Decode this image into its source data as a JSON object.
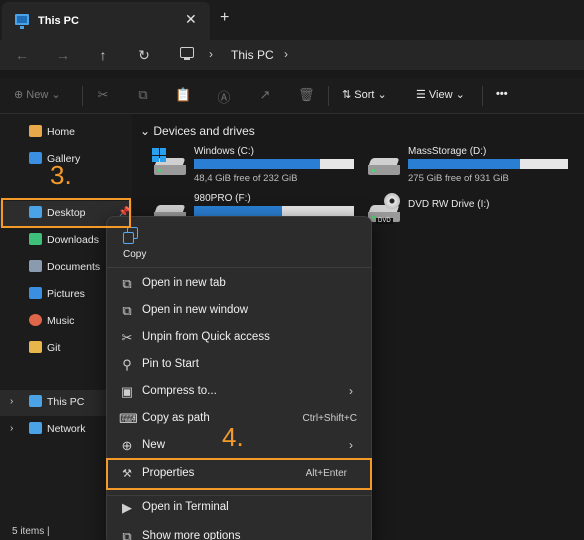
{
  "window": {
    "tab_title": "This PC",
    "tab_close": "✕",
    "new_tab": "+"
  },
  "nav": {
    "back": "←",
    "forward": "→",
    "up": "↑",
    "refresh": "↻",
    "chevron": "›",
    "location": "This PC"
  },
  "commands": {
    "new_label": "New",
    "sort_label": "Sort",
    "view_label": "View",
    "more": "•••"
  },
  "sidebar": {
    "items": [
      {
        "label": "Home",
        "icon": "home-icon",
        "color": "#e9a94b"
      },
      {
        "label": "Gallery",
        "icon": "gallery-icon",
        "color": "#3a8fe0"
      },
      {
        "label": "Desktop",
        "icon": "desktop-icon",
        "color": "#4aa3e6"
      },
      {
        "label": "Downloads",
        "icon": "downloads-icon",
        "color": "#3fc07a"
      },
      {
        "label": "Documents",
        "icon": "documents-icon",
        "color": "#8a9bb0"
      },
      {
        "label": "Pictures",
        "icon": "pictures-icon",
        "color": "#3a8fe0"
      },
      {
        "label": "Music",
        "icon": "music-icon",
        "color": "#e0664a"
      },
      {
        "label": "Git",
        "icon": "folder-icon",
        "color": "#e8b64a"
      },
      {
        "label": "This PC",
        "icon": "this-pc-icon",
        "color": "#4aa3e6"
      },
      {
        "label": "Network",
        "icon": "network-icon",
        "color": "#4aa3e6"
      }
    ],
    "status": "5 items  |"
  },
  "main": {
    "group_title": "Devices and drives",
    "drives": [
      {
        "name": "Windows (C:)",
        "free": "48,4 GiB free of 232 GiB",
        "used_fraction": 0.79
      },
      {
        "name": "MassStorage (D:)",
        "free": "275 GiB free of 931 GiB",
        "used_fraction": 0.7
      },
      {
        "name": "980PRO (F:)",
        "free": "",
        "used_fraction": 0.55
      },
      {
        "name": "DVD RW Drive (I:)",
        "free": ""
      }
    ],
    "dvd_tag": "DVD"
  },
  "context_menu": {
    "copy_label": "Copy",
    "items": [
      {
        "label": "Open in new tab",
        "icon": "open-new-tab-icon",
        "glyph": "⧉",
        "shortcut": "",
        "submenu": false
      },
      {
        "label": "Open in new window",
        "icon": "open-new-window-icon",
        "glyph": "⧉",
        "shortcut": "",
        "submenu": false
      },
      {
        "label": "Unpin from Quick access",
        "icon": "unpin-icon",
        "glyph": "✂",
        "shortcut": "",
        "submenu": false
      },
      {
        "label": "Pin to Start",
        "icon": "pin-icon",
        "glyph": "⚲",
        "shortcut": "",
        "submenu": false
      },
      {
        "label": "Compress to...",
        "icon": "compress-icon",
        "glyph": "▣",
        "shortcut": "",
        "submenu": true
      },
      {
        "label": "Copy as path",
        "icon": "copy-path-icon",
        "glyph": "⌨",
        "shortcut": "Ctrl+Shift+C",
        "submenu": false
      },
      {
        "label": "New",
        "icon": "new-icon",
        "glyph": "⊕",
        "shortcut": "",
        "submenu": true
      },
      {
        "label": "Properties",
        "icon": "properties-icon",
        "glyph": "🔧",
        "shortcut": "Alt+Enter",
        "submenu": false
      },
      {
        "label": "Open in Terminal",
        "icon": "terminal-icon",
        "glyph": "▶",
        "shortcut": "",
        "submenu": false
      },
      {
        "label": "Show more options",
        "icon": "more-options-icon",
        "glyph": "⧉",
        "shortcut": "",
        "submenu": false
      }
    ]
  },
  "annotations": {
    "step3": "3.",
    "step4": "4.",
    "highlight_color": "#f39a2b"
  }
}
